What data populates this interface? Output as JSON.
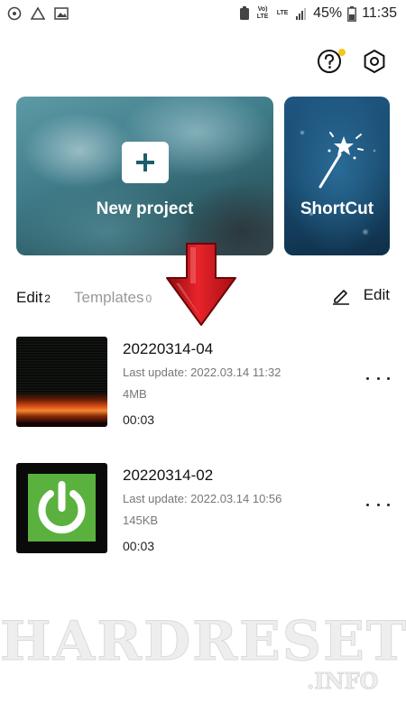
{
  "status_bar": {
    "net_label_1": "Vo)\nLTE",
    "net_label_2": "LTE",
    "battery": "45%",
    "time": "11:35"
  },
  "top_icons": [
    "help-icon",
    "settings-icon"
  ],
  "accent_dot_color": "#f5c518",
  "cards": {
    "new_project": "New project",
    "shortcut": "ShortCut"
  },
  "tabs": {
    "edit": {
      "label": "Edit",
      "count": "2"
    },
    "templates": {
      "label": "Templates",
      "count": "0"
    }
  },
  "edit_action": "Edit",
  "projects": [
    {
      "title": "20220314-04",
      "updated": "Last update: 2022.03.14 11:32",
      "size": "4MB",
      "duration": "00:03"
    },
    {
      "title": "20220314-02",
      "updated": "Last update: 2022.03.14 10:56",
      "size": "145KB",
      "duration": "00:03"
    }
  ],
  "watermark": {
    "main": "HARDRESET",
    "sub": ".INFO"
  },
  "colors": {
    "arrow": "#d4161b",
    "thumb_green": "#5ab13e"
  }
}
